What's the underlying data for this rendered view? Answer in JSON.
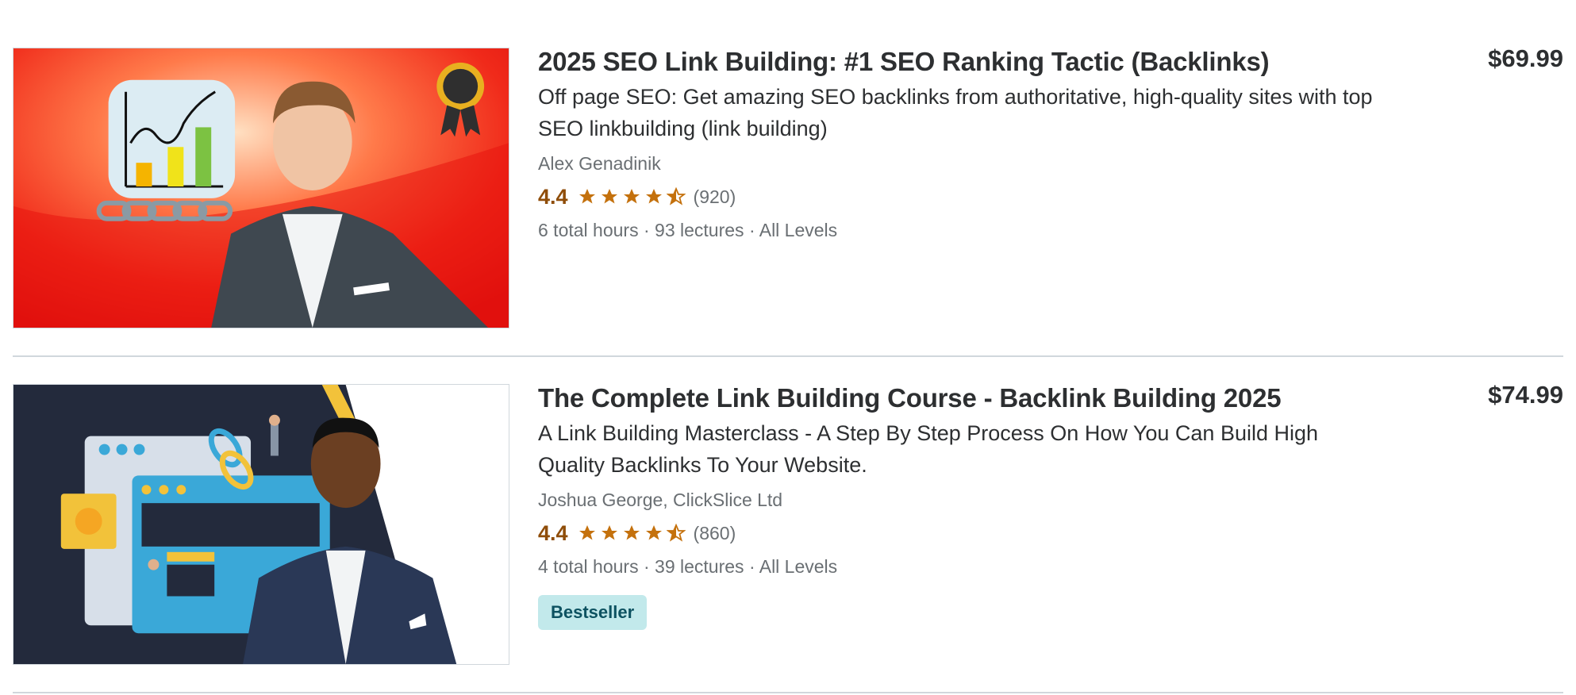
{
  "courses": [
    {
      "title": "2025 SEO Link Building: #1 SEO Ranking Tactic (Backlinks)",
      "headline": "Off page SEO: Get amazing SEO backlinks from authoritative, high-quality sites with top SEO linkbuilding (link building)",
      "instructors": "Alex Genadinik",
      "rating": "4.4",
      "stars": 4.5,
      "rating_count": "(920)",
      "hours": "6 total hours",
      "lectures": "93 lectures",
      "level": "All Levels",
      "price": "$69.99",
      "badge": "",
      "thumbnail_icon": "seo-link-building-thumbnail"
    },
    {
      "title": "The Complete Link Building Course - Backlink Building 2025",
      "headline": "A Link Building Masterclass - A Step By Step Process On How You Can Build High Quality Backlinks To Your Website.",
      "instructors": "Joshua George, ClickSlice Ltd",
      "rating": "4.4",
      "stars": 4.5,
      "rating_count": "(860)",
      "hours": "4 total hours",
      "lectures": "39 lectures",
      "level": "All Levels",
      "price": "$74.99",
      "badge": "Bestseller",
      "thumbnail_icon": "link-building-course-thumbnail"
    }
  ],
  "meta_separator": " · ",
  "colors": {
    "rating": "#8f4d09",
    "star": "#c4710d",
    "badge_bg": "#c2e9eb",
    "badge_text": "#0d5261"
  }
}
